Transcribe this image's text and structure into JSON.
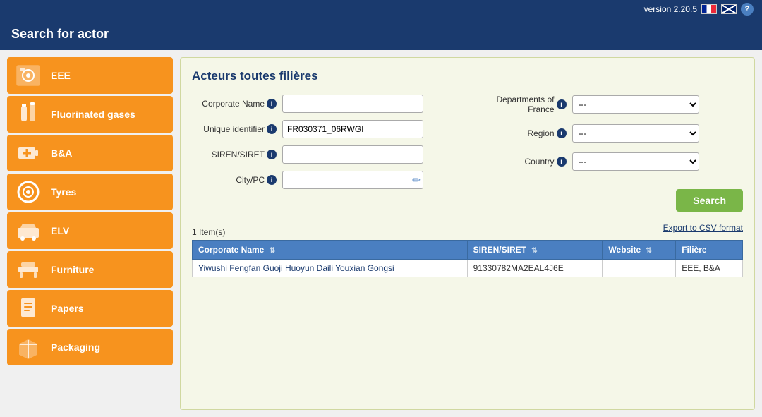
{
  "topbar": {
    "version": "version 2.20.5",
    "help_label": "?"
  },
  "header": {
    "title": "Search for actor"
  },
  "sidebar": {
    "items": [
      {
        "id": "eee",
        "label": "EEE",
        "icon": "washer"
      },
      {
        "id": "fluorinated",
        "label": "Fluorinated gases",
        "icon": "gas"
      },
      {
        "id": "bna",
        "label": "B&A",
        "icon": "battery"
      },
      {
        "id": "tyres",
        "label": "Tyres",
        "icon": "tyre"
      },
      {
        "id": "elv",
        "label": "ELV",
        "icon": "car"
      },
      {
        "id": "furniture",
        "label": "Furniture",
        "icon": "furniture"
      },
      {
        "id": "papers",
        "label": "Papers",
        "icon": "papers"
      },
      {
        "id": "packaging",
        "label": "Packaging",
        "icon": "packaging"
      }
    ]
  },
  "content": {
    "section_title": "Acteurs toutes filières",
    "form": {
      "corporate_name_label": "Corporate Name",
      "unique_identifier_label": "Unique identifier",
      "siren_siret_label": "SIREN/SIRET",
      "city_pc_label": "City/PC",
      "departments_france_label": "Departments of France",
      "region_label": "Region",
      "country_label": "Country",
      "corporate_name_value": "",
      "unique_identifier_value": "FR030371_06RWGI",
      "siren_siret_value": "",
      "city_pc_value": "",
      "departments_france_value": "---",
      "region_value": "---",
      "country_value": "---",
      "search_button": "Search",
      "export_link": "Export to CSV format"
    },
    "results": {
      "count_label": "1 Item(s)",
      "columns": [
        "Corporate Name",
        "SIREN/SIRET",
        "Website",
        "Filière"
      ],
      "rows": [
        {
          "corporate_name": "Yiwushi Fengfan Guoji Huoyun Daili Youxian Gongsi",
          "siren_siret": "91330782MA2EAL4J6E",
          "website": "",
          "filiere": "EEE, B&A"
        }
      ]
    }
  }
}
